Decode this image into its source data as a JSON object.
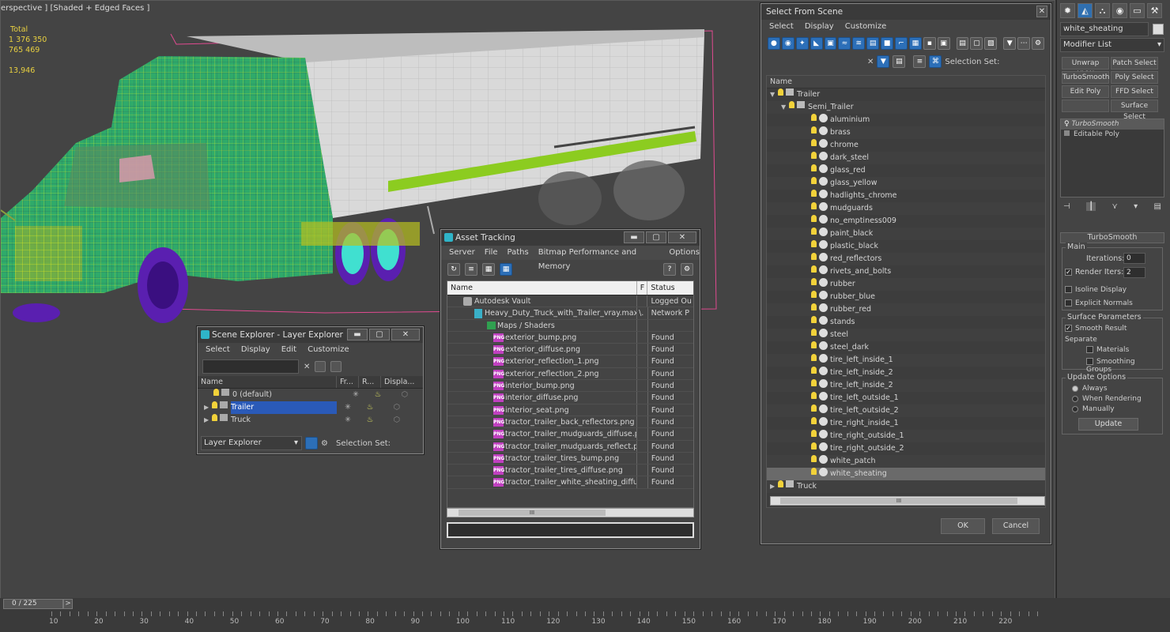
{
  "viewport": {
    "label": "erspective ] [Shaded + Edged Faces ]",
    "stats": {
      "total_label": "Total",
      "polys_value": "1 376 350",
      "verts_value": "765 469",
      "fps_value": "13,946"
    }
  },
  "layer_explorer": {
    "title": "Scene Explorer - Layer Explorer",
    "menu": [
      "Select",
      "Display",
      "Edit",
      "Customize"
    ],
    "columns": [
      "Name",
      "Fr...",
      "R...",
      "Displa..."
    ],
    "rows": [
      {
        "name": "0 (default)",
        "selected": false
      },
      {
        "name": "Trailer",
        "selected": true
      },
      {
        "name": "Truck",
        "selected": false
      }
    ],
    "footer_dropdown": "Layer Explorer",
    "selection_set_label": "Selection Set:"
  },
  "asset_tracking": {
    "title": "Asset Tracking",
    "menu": [
      "Server",
      "File",
      "Paths",
      "Bitmap Performance and Memory",
      "Options"
    ],
    "columns": [
      "Name",
      "F",
      "Status"
    ],
    "rows": [
      {
        "name": "Autodesk Vault",
        "f": "",
        "status": "Logged Ou",
        "indent": 1,
        "kind": "vault"
      },
      {
        "name": "Heavy_Duty_Truck_with_Trailer_vray.max",
        "f": "\\.",
        "status": "Network P",
        "indent": 2,
        "kind": "max"
      },
      {
        "name": "Maps / Shaders",
        "f": "",
        "status": "",
        "indent": 3,
        "kind": "maps"
      },
      {
        "name": "exterior_bump.png",
        "f": "",
        "status": "Found",
        "indent": 4,
        "kind": "png"
      },
      {
        "name": "exterior_diffuse.png",
        "f": "",
        "status": "Found",
        "indent": 4,
        "kind": "png"
      },
      {
        "name": "exterior_reflection_1.png",
        "f": "",
        "status": "Found",
        "indent": 4,
        "kind": "png"
      },
      {
        "name": "exterior_reflection_2.png",
        "f": "",
        "status": "Found",
        "indent": 4,
        "kind": "png"
      },
      {
        "name": "interior_bump.png",
        "f": "",
        "status": "Found",
        "indent": 4,
        "kind": "png"
      },
      {
        "name": "interior_diffuse.png",
        "f": "",
        "status": "Found",
        "indent": 4,
        "kind": "png"
      },
      {
        "name": "interior_seat.png",
        "f": "",
        "status": "Found",
        "indent": 4,
        "kind": "png"
      },
      {
        "name": "tractor_trailer_back_reflectors.png",
        "f": "",
        "status": "Found",
        "indent": 4,
        "kind": "png"
      },
      {
        "name": "tractor_trailer_mudguards_diffuse.png",
        "f": "",
        "status": "Found",
        "indent": 4,
        "kind": "png"
      },
      {
        "name": "tractor_trailer_mudguards_reflect.png",
        "f": "",
        "status": "Found",
        "indent": 4,
        "kind": "png"
      },
      {
        "name": "tractor_trailer_tires_bump.png",
        "f": "",
        "status": "Found",
        "indent": 4,
        "kind": "png"
      },
      {
        "name": "tractor_trailer_tires_diffuse.png",
        "f": "",
        "status": "Found",
        "indent": 4,
        "kind": "png"
      },
      {
        "name": "tractor_trailer_white_sheating_diffuse.p...",
        "f": "",
        "status": "Found",
        "indent": 4,
        "kind": "png"
      }
    ],
    "scroll_label": "III"
  },
  "select_from_scene": {
    "title": "Select From Scene",
    "menu": [
      "Select",
      "Display",
      "Customize"
    ],
    "selection_set_label": "Selection Set:",
    "name_header": "Name",
    "tree": [
      {
        "name": "Trailer",
        "level": 0,
        "exp": "▼",
        "kind": "layer"
      },
      {
        "name": "Semi_Trailer",
        "level": 1,
        "exp": "▼",
        "kind": "layer"
      },
      {
        "name": "aluminium",
        "level": 2,
        "exp": "",
        "kind": "obj"
      },
      {
        "name": "brass",
        "level": 2,
        "exp": "",
        "kind": "obj"
      },
      {
        "name": "chrome",
        "level": 2,
        "exp": "",
        "kind": "obj"
      },
      {
        "name": "dark_steel",
        "level": 2,
        "exp": "",
        "kind": "obj"
      },
      {
        "name": "glass_red",
        "level": 2,
        "exp": "",
        "kind": "obj"
      },
      {
        "name": "glass_yellow",
        "level": 2,
        "exp": "",
        "kind": "obj"
      },
      {
        "name": "hadlights_chrome",
        "level": 2,
        "exp": "",
        "kind": "obj"
      },
      {
        "name": "mudguards",
        "level": 2,
        "exp": "",
        "kind": "obj"
      },
      {
        "name": "no_emptiness009",
        "level": 2,
        "exp": "",
        "kind": "obj"
      },
      {
        "name": "paint_black",
        "level": 2,
        "exp": "",
        "kind": "obj"
      },
      {
        "name": "plastic_black",
        "level": 2,
        "exp": "",
        "kind": "obj"
      },
      {
        "name": "red_reflectors",
        "level": 2,
        "exp": "",
        "kind": "obj"
      },
      {
        "name": "rivets_and_bolts",
        "level": 2,
        "exp": "",
        "kind": "obj"
      },
      {
        "name": "rubber",
        "level": 2,
        "exp": "",
        "kind": "obj"
      },
      {
        "name": "rubber_blue",
        "level": 2,
        "exp": "",
        "kind": "obj"
      },
      {
        "name": "rubber_red",
        "level": 2,
        "exp": "",
        "kind": "obj"
      },
      {
        "name": "stands",
        "level": 2,
        "exp": "",
        "kind": "obj"
      },
      {
        "name": "steel",
        "level": 2,
        "exp": "",
        "kind": "obj"
      },
      {
        "name": "steel_dark",
        "level": 2,
        "exp": "",
        "kind": "obj"
      },
      {
        "name": "tire_left_inside_1",
        "level": 2,
        "exp": "",
        "kind": "obj"
      },
      {
        "name": "tire_left_inside_2",
        "level": 2,
        "exp": "",
        "kind": "obj"
      },
      {
        "name": "tire_left_inside_2",
        "level": 2,
        "exp": "",
        "kind": "obj"
      },
      {
        "name": "tire_left_outside_1",
        "level": 2,
        "exp": "",
        "kind": "obj"
      },
      {
        "name": "tire_left_outside_2",
        "level": 2,
        "exp": "",
        "kind": "obj"
      },
      {
        "name": "tire_right_inside_1",
        "level": 2,
        "exp": "",
        "kind": "obj"
      },
      {
        "name": "tire_right_outside_1",
        "level": 2,
        "exp": "",
        "kind": "obj"
      },
      {
        "name": "tire_right_outside_2",
        "level": 2,
        "exp": "",
        "kind": "obj"
      },
      {
        "name": "white_patch",
        "level": 2,
        "exp": "",
        "kind": "obj"
      },
      {
        "name": "white_sheating",
        "level": 2,
        "exp": "",
        "kind": "obj",
        "highlight": true
      },
      {
        "name": "Truck",
        "level": 0,
        "exp": "▶",
        "kind": "layer"
      }
    ],
    "scroll_label": "III",
    "ok_label": "OK",
    "cancel_label": "Cancel"
  },
  "command_panel": {
    "object_name": "white_sheating",
    "modifier_list_label": "Modifier List",
    "modifier_buttons": [
      "Unwrap UVW",
      "Patch Select",
      "TurboSmooth",
      "Poly Select",
      "Edit Poly",
      "FFD Select",
      "",
      "Surface Select"
    ],
    "stack": [
      {
        "name": "TurboSmooth",
        "italic": true
      },
      {
        "name": "Editable Poly",
        "italic": false
      }
    ],
    "rollout_title": "TurboSmooth",
    "main_label": "Main",
    "iterations_label": "Iterations:",
    "iterations_value": "0",
    "render_iters_label": "Render Iters:",
    "render_iters_value": "2",
    "isoline_label": "Isoline Display",
    "explicit_normals_label": "Explicit Normals",
    "surface_params_label": "Surface Parameters",
    "smooth_result_label": "Smooth Result",
    "separate_label": "Separate",
    "materials_label": "Materials",
    "smoothing_groups_label": "Smoothing Groups",
    "update_options_label": "Update Options",
    "always_label": "Always",
    "when_rendering_label": "When Rendering",
    "manually_label": "Manually",
    "update_button": "Update"
  },
  "timeline": {
    "frame_label": "0 / 225",
    "next_label": ">",
    "ticks": [
      "10",
      "20",
      "30",
      "40",
      "50",
      "60",
      "70",
      "80",
      "90",
      "100",
      "110",
      "120",
      "130",
      "140",
      "150",
      "160",
      "170",
      "180",
      "190",
      "200",
      "210",
      "220"
    ]
  },
  "colors": {
    "accent_blue": "#2a5ab8",
    "wire_green": "#2faa6a",
    "wire_yellow": "#d8e020",
    "tire_purple": "#5a1fb0",
    "trailer_stripe": "#8ccc20"
  }
}
